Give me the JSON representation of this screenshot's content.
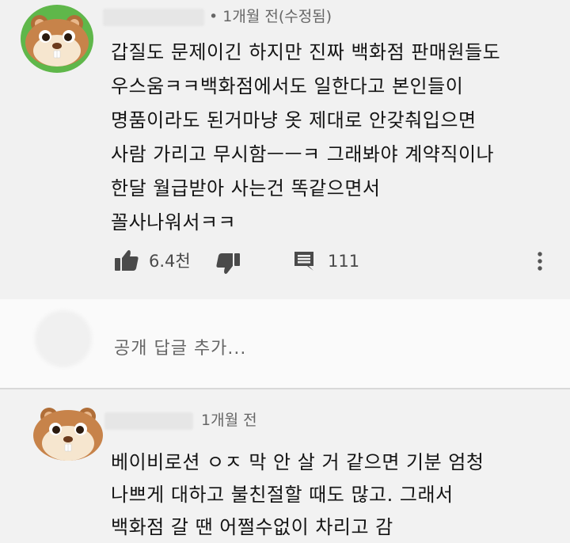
{
  "comment1": {
    "time": "• 1개월 전(수정됨)",
    "lines": [
      "갑질도 문제이긴 하지만 진짜 백화점 판매원들도",
      "우스움ㅋㅋ백화점에서도 일한다고 본인들이",
      "명품이라도 된거마냥 옷 제대로 안갖춰입으면",
      "사람 가리고 무시함ㅡㅡㅋ 그래봐야 계약직이나",
      "한달 월급받아 사는건 똑같으면서",
      "꼴사나워서ㅋㅋ"
    ],
    "like_count": "6.4천",
    "reply_count": "111",
    "icons": {
      "like": "thumb-up-icon",
      "dislike": "thumb-down-icon",
      "replies": "comment-icon",
      "more": "more-vertical-icon"
    }
  },
  "reply_box": {
    "placeholder": "공개 답글 추가..."
  },
  "comment2": {
    "time": "1개월 전",
    "lines": [
      "베이비로션 ㅇㅈ 막 안 살 거 같으면 기분 엄청",
      "나쁘게 대하고 불친절할 때도 많고. 그래서",
      "백화점 갈 땐 어쩔수없이 차리고 감"
    ]
  },
  "colors": {
    "avatar_bg": "#5fb74a",
    "hamster_fur": "#c7834a",
    "hamster_face": "#f6e6cf"
  }
}
